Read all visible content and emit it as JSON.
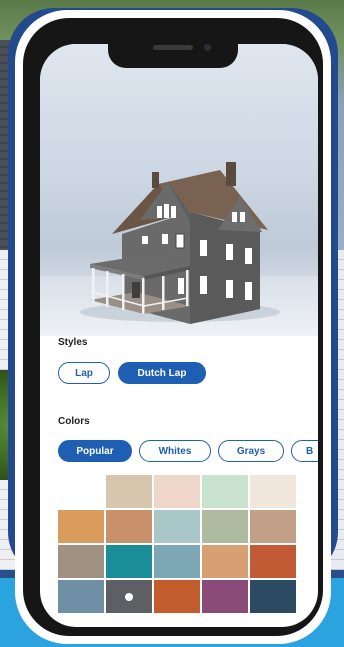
{
  "styles": {
    "title": "Styles",
    "options": [
      {
        "label": "Lap",
        "selected": false
      },
      {
        "label": "Dutch Lap",
        "selected": true
      }
    ]
  },
  "colors": {
    "title": "Colors",
    "tabs": [
      {
        "label": "Popular",
        "selected": true
      },
      {
        "label": "Whites",
        "selected": false
      },
      {
        "label": "Grays",
        "selected": false
      },
      {
        "label": "B",
        "selected": false
      }
    ],
    "swatches": [
      [
        "#ffffff",
        "#d7c6ae",
        "#eed6c8",
        "#c9e3cf",
        "#f0e6dc"
      ],
      [
        "#d99c5c",
        "#c9906c",
        "#a9c7c9",
        "#aebba1",
        "#c2a088"
      ],
      [
        "#a09283",
        "#1a8e98",
        "#7ea7b5",
        "#d7a072",
        "#c25a36"
      ],
      [
        "#6f8fa5",
        "#5d5f65",
        "#c45d2e",
        "#8a4a7a",
        "#2c4a62"
      ]
    ],
    "selected_swatch": "#5d5f65"
  },
  "accent_color": "#1f5fb3"
}
